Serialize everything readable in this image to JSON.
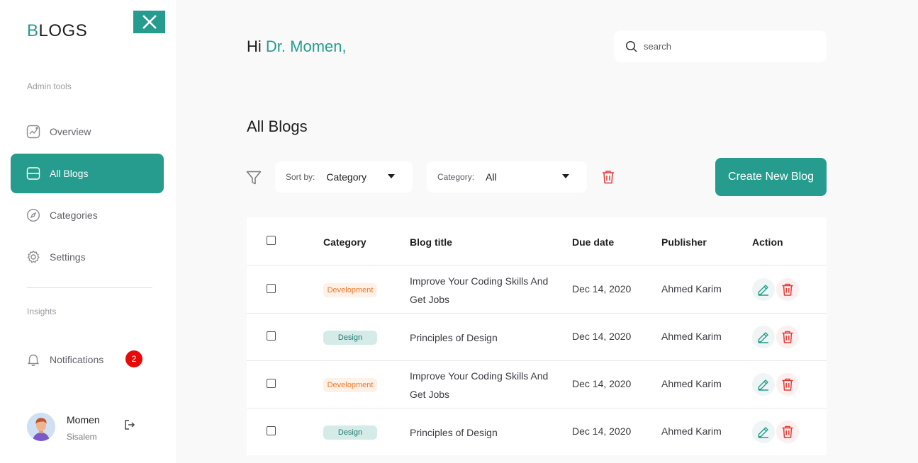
{
  "sidebar": {
    "logo_first": "B",
    "logo_rest": "LOGS",
    "section_admin": "Admin tools",
    "section_insights": "Insights",
    "items": [
      {
        "label": "Overview",
        "icon": "chart-icon"
      },
      {
        "label": "All Blogs",
        "icon": "blogs-icon"
      },
      {
        "label": "Categories",
        "icon": "compass-icon"
      },
      {
        "label": "Settings",
        "icon": "gear-icon"
      }
    ],
    "notifications_label": "Notifications",
    "notifications_count": "2",
    "user_first": "Momen",
    "user_last": "Sisalem"
  },
  "header": {
    "greeting": "Hi",
    "name": "Dr. Momen,",
    "search_placeholder": "search"
  },
  "main": {
    "title": "All Blogs",
    "sort_label": "Sort by:",
    "sort_value": "Category",
    "category_label": "Category:",
    "category_value": "All",
    "create_button": "Create New Blog"
  },
  "table": {
    "columns": [
      "Category",
      "Blog title",
      "Due date",
      "Publisher",
      "Action"
    ],
    "rows": [
      {
        "category": "Development",
        "title": "Improve Your Coding Skills And Get Jobs",
        "date": "Dec 14, 2020",
        "publisher": "Ahmed Karim"
      },
      {
        "category": "Design",
        "title": "Principles of Design",
        "date": "Dec 14, 2020",
        "publisher": "Ahmed Karim"
      },
      {
        "category": "Development",
        "title": "Improve Your Coding Skills And Get Jobs",
        "date": "Dec 14, 2020",
        "publisher": "Ahmed Karim"
      },
      {
        "category": "Design",
        "title": "Principles of Design",
        "date": "Dec 14, 2020",
        "publisher": "Ahmed Karim"
      }
    ]
  },
  "colors": {
    "accent": "#269c8e",
    "danger": "#e53935",
    "development_text": "#f07a2a",
    "development_bg": "#fdf1e8",
    "design_bg": "#d4ebe7"
  }
}
